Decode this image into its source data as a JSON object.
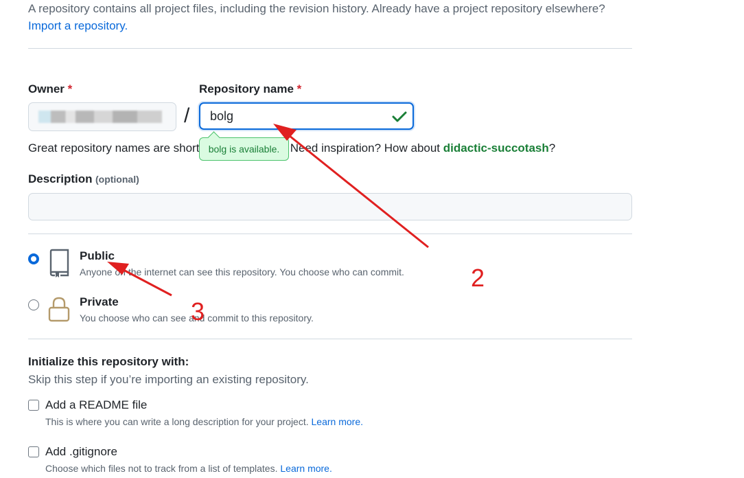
{
  "intro": {
    "text": "A repository contains all project files, including the revision history. Already have a project repository elsewhere?",
    "import_link": "Import a repository."
  },
  "owner": {
    "label": "Owner",
    "required_mark": "*"
  },
  "separator": "/",
  "repo_name": {
    "label": "Repository name",
    "required_mark": "*",
    "value": "bolg",
    "availability": "bolg is available."
  },
  "hint": {
    "prefix": "Great repository names are short and memorable. Need inspiration? How about ",
    "suggestion": "didactic-succotash",
    "suffix": "?"
  },
  "description": {
    "label": "Description",
    "optional": "(optional)",
    "value": ""
  },
  "visibility": {
    "public": {
      "title": "Public",
      "desc": "Anyone on the internet can see this repository. You choose who can commit.",
      "checked": true
    },
    "private": {
      "title": "Private",
      "desc": "You choose who can see and commit to this repository.",
      "checked": false
    }
  },
  "initialize": {
    "heading": "Initialize this repository with:",
    "subtitle": "Skip this step if you’re importing an existing repository.",
    "readme": {
      "label": "Add a README file",
      "desc": "This is where you can write a long description for your project.",
      "link": "Learn more."
    },
    "gitignore": {
      "label": "Add .gitignore",
      "desc": "Choose which files not to track from a list of templates.",
      "link": "Learn more."
    }
  },
  "annotations": {
    "two": "2",
    "three": "3"
  },
  "colors": {
    "accent": "#0969da",
    "success": "#1a7f37",
    "annotation": "#e02020"
  }
}
